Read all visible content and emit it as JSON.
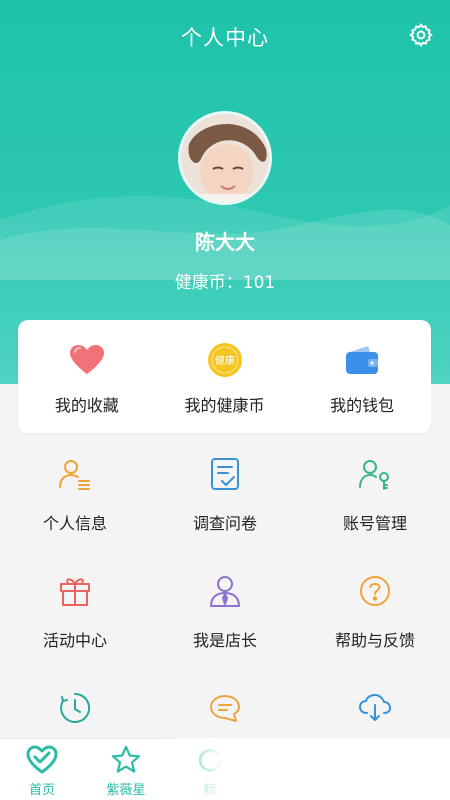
{
  "header": {
    "title": "个人中心",
    "settings_icon": "gear-icon"
  },
  "profile": {
    "name": "陈大大",
    "coins_text": "健康币：101"
  },
  "card": [
    {
      "label": "我的收藏",
      "icon": "heart-icon"
    },
    {
      "label": "我的健康币",
      "icon": "coin-icon",
      "icon_text": "健康"
    },
    {
      "label": "我的钱包",
      "icon": "wallet-icon"
    }
  ],
  "grid": [
    {
      "label": "个人信息",
      "icon": "person-info-icon"
    },
    {
      "label": "调查问卷",
      "icon": "questionnaire-icon"
    },
    {
      "label": "账号管理",
      "icon": "account-manage-icon"
    },
    {
      "label": "活动中心",
      "icon": "gift-icon"
    },
    {
      "label": "我是店长",
      "icon": "store-manager-icon"
    },
    {
      "label": "帮助与反馈",
      "icon": "help-icon"
    },
    {
      "label": "",
      "icon": "clock-icon"
    },
    {
      "label": "",
      "icon": "chat-icon"
    },
    {
      "label": "",
      "icon": "cloud-download-icon"
    }
  ],
  "bottom_nav": [
    {
      "label": "首页",
      "icon": "home-heart-icon"
    },
    {
      "label": "紫薇星",
      "icon": "star-icon"
    },
    {
      "label": "精",
      "icon": "refresh-icon"
    }
  ],
  "colors": {
    "brand": "#29bba6",
    "heart": "#f2727a",
    "coin": "#f6c521",
    "wallet": "#3c8fe8",
    "orange": "#f0a33c",
    "blue": "#3a92d6",
    "green": "#39b583",
    "red": "#e9645c",
    "purple": "#8a72d1",
    "teal": "#27a7a0"
  }
}
